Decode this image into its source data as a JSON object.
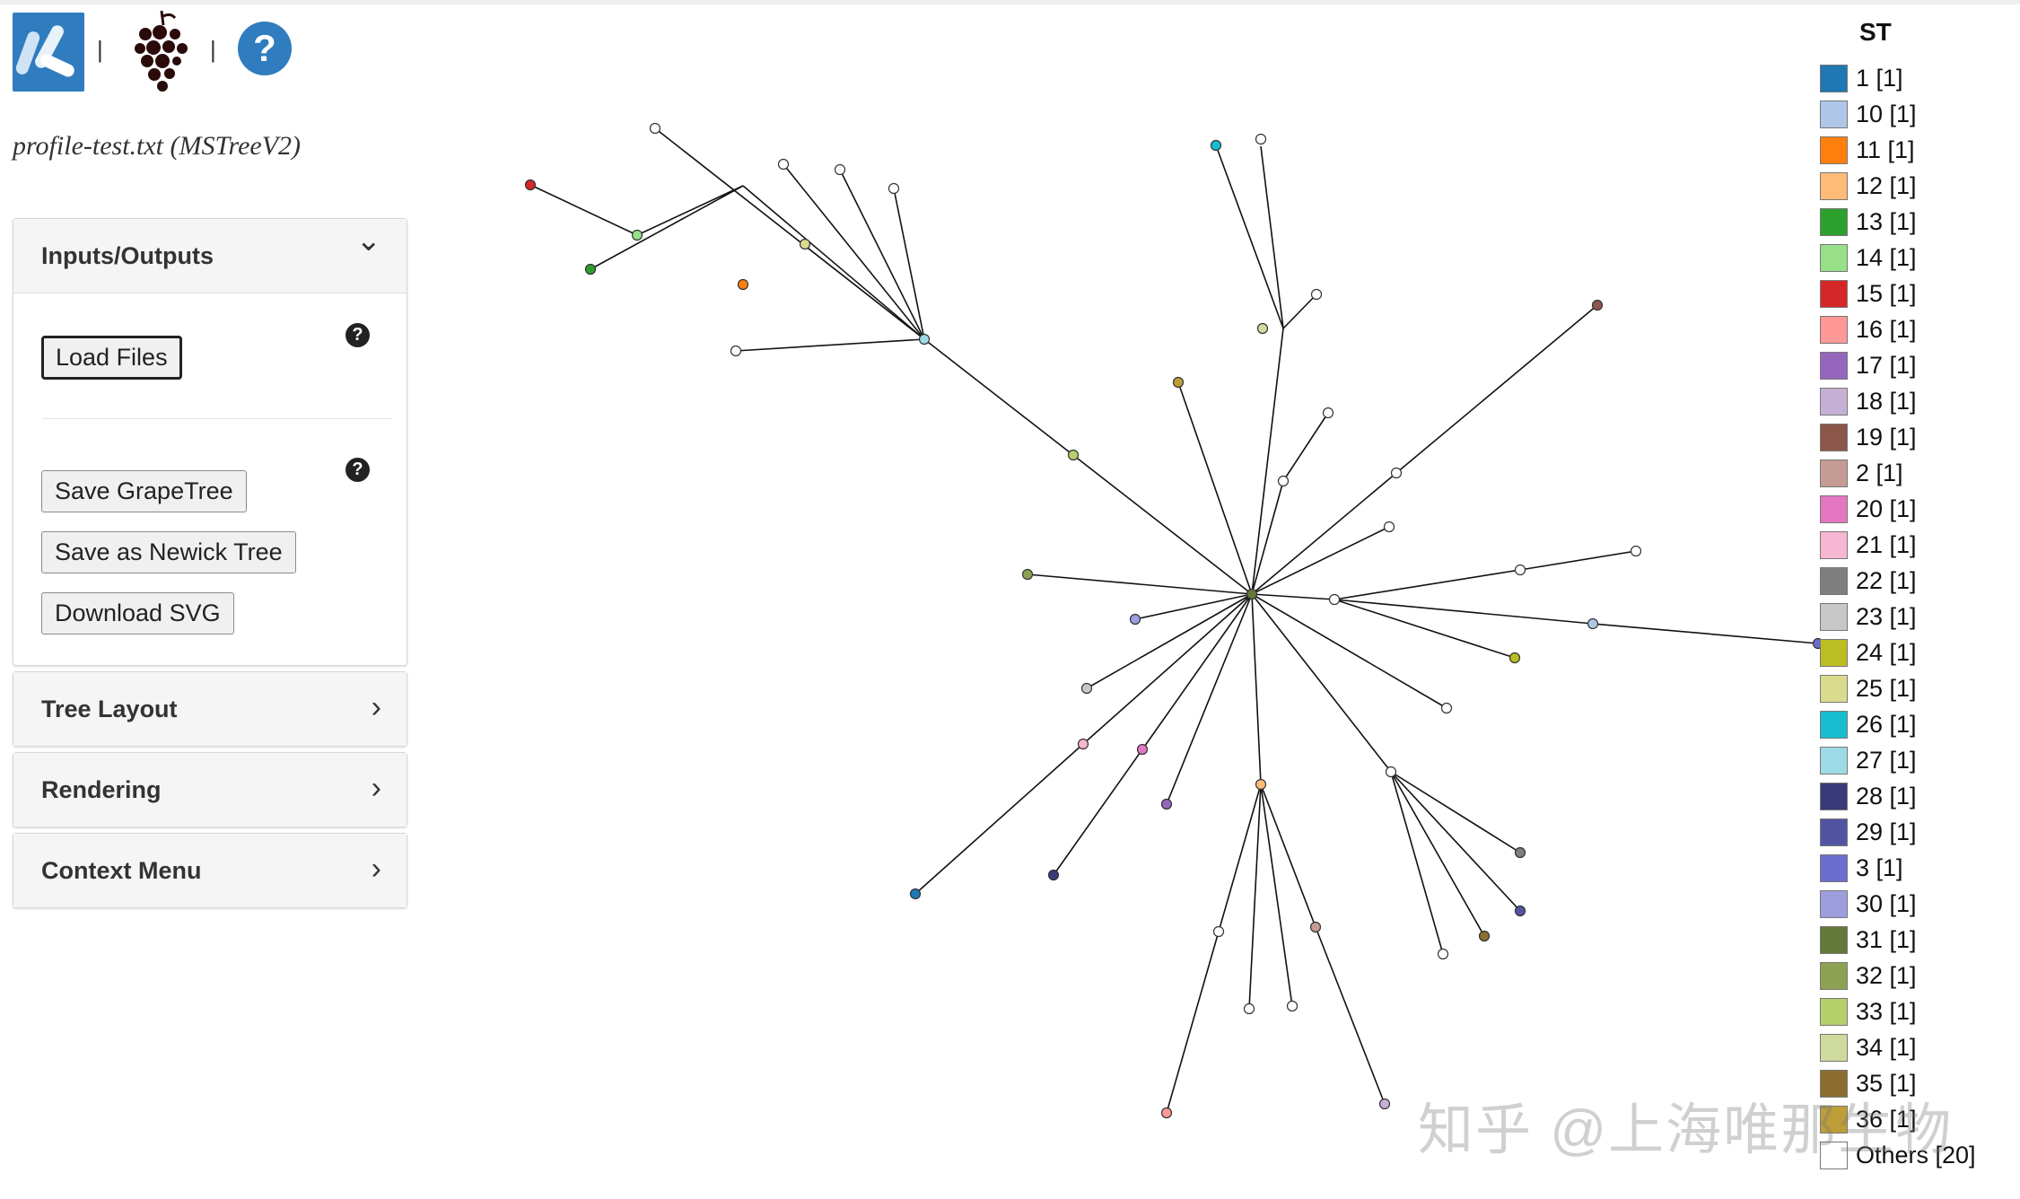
{
  "header": {
    "separator": "|",
    "help_symbol": "?",
    "file_title": "profile-test.txt (MSTreeV2)"
  },
  "panels": {
    "inputs_outputs": {
      "title": "Inputs/Outputs",
      "load_files": "Load Files",
      "save_grapetree": "Save GrapeTree",
      "save_newick": "Save as Newick Tree",
      "download_svg": "Download SVG",
      "help_symbol": "?"
    },
    "tree_layout": {
      "title": "Tree Layout"
    },
    "rendering": {
      "title": "Rendering"
    },
    "context_menu": {
      "title": "Context Menu"
    }
  },
  "icons": {
    "chevron_down": "⌄",
    "chevron_right": "›"
  },
  "legend": {
    "title": "ST",
    "items": [
      {
        "label": "1 [1]",
        "color": "#1f77b4"
      },
      {
        "label": "10 [1]",
        "color": "#aec7e8"
      },
      {
        "label": "11 [1]",
        "color": "#ff7f0e"
      },
      {
        "label": "12 [1]",
        "color": "#ffbb78"
      },
      {
        "label": "13 [1]",
        "color": "#2ca02c"
      },
      {
        "label": "14 [1]",
        "color": "#98df8a"
      },
      {
        "label": "15 [1]",
        "color": "#d62728"
      },
      {
        "label": "16 [1]",
        "color": "#ff9896"
      },
      {
        "label": "17 [1]",
        "color": "#9467bd"
      },
      {
        "label": "18 [1]",
        "color": "#c5b0d5"
      },
      {
        "label": "19 [1]",
        "color": "#8c564b"
      },
      {
        "label": "2 [1]",
        "color": "#c49c94"
      },
      {
        "label": "20 [1]",
        "color": "#e377c2"
      },
      {
        "label": "21 [1]",
        "color": "#f7b6d2"
      },
      {
        "label": "22 [1]",
        "color": "#7f7f7f"
      },
      {
        "label": "23 [1]",
        "color": "#c7c7c7"
      },
      {
        "label": "24 [1]",
        "color": "#bcbd22"
      },
      {
        "label": "25 [1]",
        "color": "#dbdb8d"
      },
      {
        "label": "26 [1]",
        "color": "#17becf"
      },
      {
        "label": "27 [1]",
        "color": "#9edae5"
      },
      {
        "label": "28 [1]",
        "color": "#393b79"
      },
      {
        "label": "29 [1]",
        "color": "#5254a3"
      },
      {
        "label": "3 [1]",
        "color": "#6b6ecf"
      },
      {
        "label": "30 [1]",
        "color": "#9c9ede"
      },
      {
        "label": "31 [1]",
        "color": "#637939"
      },
      {
        "label": "32 [1]",
        "color": "#8ca252"
      },
      {
        "label": "33 [1]",
        "color": "#b5cf6b"
      },
      {
        "label": "34 [1]",
        "color": "#cedb9c"
      },
      {
        "label": "35 [1]",
        "color": "#8c6d31"
      },
      {
        "label": "36 [1]",
        "color": "#bd9e39"
      },
      {
        "label": "Others [20]",
        "color": "#ffffff"
      }
    ]
  },
  "watermark": "知乎 @上海唯那生物"
}
